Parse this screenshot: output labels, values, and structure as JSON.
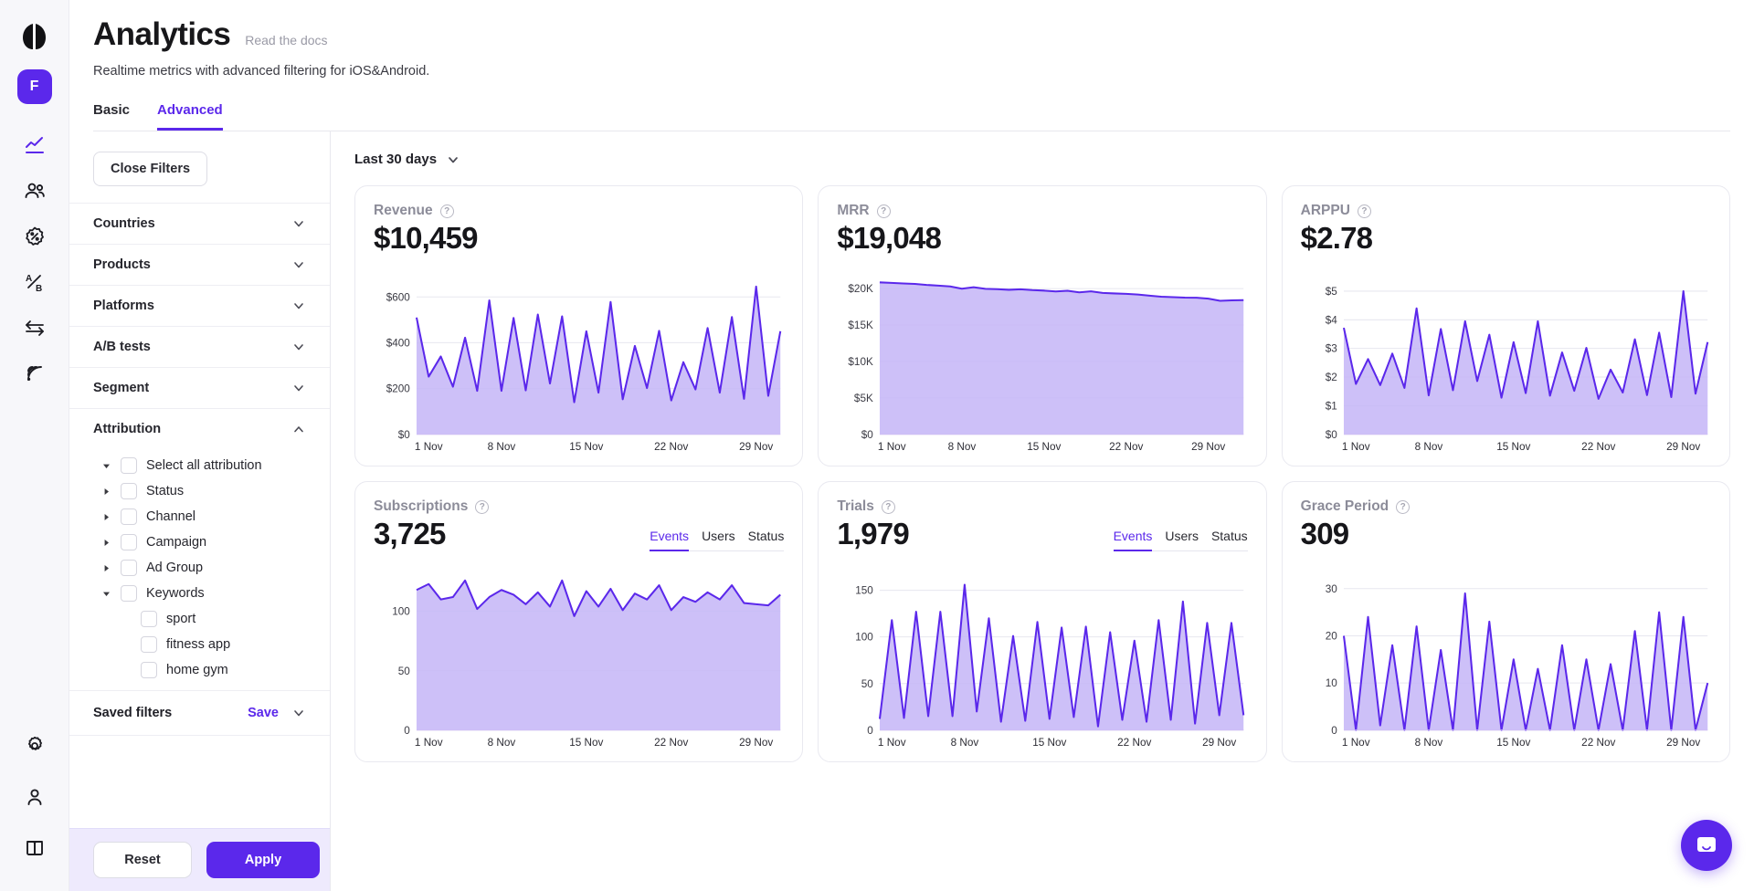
{
  "brand": {
    "accent": "#5b28eb",
    "area_fill": "#c4b5f7",
    "workspace_initial": "F"
  },
  "rail": {
    "items": [
      {
        "name": "analytics-icon",
        "label": "Analytics",
        "active": true
      },
      {
        "name": "users-icon",
        "label": "Users",
        "active": false
      },
      {
        "name": "promo-icon",
        "label": "Promo",
        "active": false
      },
      {
        "name": "ab-test-icon",
        "label": "A/B Tests",
        "active": false
      },
      {
        "name": "integrations-icon",
        "label": "Integrations",
        "active": false
      },
      {
        "name": "broadcast-icon",
        "label": "Broadcast",
        "active": false
      }
    ],
    "bottom": [
      {
        "name": "gear-icon",
        "label": "Settings"
      },
      {
        "name": "user-icon",
        "label": "Account"
      },
      {
        "name": "docs-icon",
        "label": "Docs"
      }
    ]
  },
  "header": {
    "title": "Analytics",
    "docs_link": "Read the docs",
    "subtitle": "Realtime metrics with advanced filtering for iOS&Android.",
    "tabs": [
      {
        "label": "Basic",
        "active": false
      },
      {
        "label": "Advanced",
        "active": true
      }
    ]
  },
  "filters": {
    "close_button": "Close Filters",
    "facets": [
      {
        "label": "Countries",
        "expanded": false
      },
      {
        "label": "Products",
        "expanded": false
      },
      {
        "label": "Platforms",
        "expanded": false
      },
      {
        "label": "A/B tests",
        "expanded": false
      },
      {
        "label": "Segment",
        "expanded": false
      },
      {
        "label": "Attribution",
        "expanded": true
      }
    ],
    "attribution_tree": [
      {
        "label": "Select all attribution",
        "caret": "down",
        "indent": 0,
        "checked": false
      },
      {
        "label": "Status",
        "caret": "right",
        "indent": 0,
        "checked": false
      },
      {
        "label": "Channel",
        "caret": "right",
        "indent": 0,
        "checked": false
      },
      {
        "label": "Campaign",
        "caret": "right",
        "indent": 0,
        "checked": false
      },
      {
        "label": "Ad Group",
        "caret": "right",
        "indent": 0,
        "checked": false
      },
      {
        "label": "Keywords",
        "caret": "down",
        "indent": 0,
        "checked": false
      },
      {
        "label": "sport",
        "caret": "none",
        "indent": 1,
        "checked": false
      },
      {
        "label": "fitness app",
        "caret": "none",
        "indent": 1,
        "checked": false
      },
      {
        "label": "home gym",
        "caret": "none",
        "indent": 1,
        "checked": false
      }
    ],
    "saved_filters_label": "Saved filters",
    "save_link": "Save",
    "reset_button": "Reset",
    "apply_button": "Apply"
  },
  "toolbar": {
    "date_range": "Last 30 days"
  },
  "chart_data": [
    {
      "type": "area",
      "title": "Revenue",
      "metric": "$10,459",
      "xlabel": "",
      "ylabel": "",
      "ylim": [
        0,
        700
      ],
      "yticks": [
        0,
        200,
        400,
        600
      ],
      "ytick_labels": [
        "$0",
        "$200",
        "$400",
        "$600"
      ],
      "xtick_labels": [
        "1 Nov",
        "8 Nov",
        "15 Nov",
        "22 Nov",
        "29 Nov"
      ],
      "xtick_indices": [
        0,
        7,
        14,
        21,
        28
      ],
      "x": [
        "1 Nov",
        "2 Nov",
        "3 Nov",
        "4 Nov",
        "5 Nov",
        "6 Nov",
        "7 Nov",
        "8 Nov",
        "9 Nov",
        "10 Nov",
        "11 Nov",
        "12 Nov",
        "13 Nov",
        "14 Nov",
        "15 Nov",
        "16 Nov",
        "17 Nov",
        "18 Nov",
        "19 Nov",
        "20 Nov",
        "21 Nov",
        "22 Nov",
        "23 Nov",
        "24 Nov",
        "25 Nov",
        "26 Nov",
        "27 Nov",
        "28 Nov",
        "29 Nov",
        "30 Nov"
      ],
      "values": [
        510,
        252,
        340,
        208,
        422,
        190,
        585,
        190,
        508,
        192,
        523,
        222,
        515,
        140,
        450,
        182,
        578,
        153,
        386,
        202,
        452,
        148,
        315,
        196,
        464,
        182,
        512,
        155,
        645,
        168,
        450
      ],
      "grid": true,
      "legend": null
    },
    {
      "type": "area",
      "title": "MRR",
      "metric": "$19,048",
      "xlabel": "",
      "ylabel": "",
      "ylim": [
        0,
        22000
      ],
      "yticks": [
        0,
        5000,
        10000,
        15000,
        20000
      ],
      "ytick_labels": [
        "$0",
        "$5K",
        "$10K",
        "$15K",
        "$20K"
      ],
      "xtick_labels": [
        "1 Nov",
        "8 Nov",
        "15 Nov",
        "22 Nov",
        "29 Nov"
      ],
      "xtick_indices": [
        0,
        7,
        14,
        21,
        28
      ],
      "x": [
        "1 Nov",
        "2 Nov",
        "3 Nov",
        "4 Nov",
        "5 Nov",
        "6 Nov",
        "7 Nov",
        "8 Nov",
        "9 Nov",
        "10 Nov",
        "11 Nov",
        "12 Nov",
        "13 Nov",
        "14 Nov",
        "15 Nov",
        "16 Nov",
        "17 Nov",
        "18 Nov",
        "19 Nov",
        "20 Nov",
        "21 Nov",
        "22 Nov",
        "23 Nov",
        "24 Nov",
        "25 Nov",
        "26 Nov",
        "27 Nov",
        "28 Nov",
        "29 Nov",
        "30 Nov"
      ],
      "values": [
        20850,
        20780,
        20700,
        20640,
        20500,
        20400,
        20290,
        19980,
        20180,
        19970,
        19920,
        19830,
        19900,
        19790,
        19720,
        19600,
        19700,
        19480,
        19620,
        19400,
        19330,
        19280,
        19180,
        19020,
        18880,
        18820,
        18760,
        18740,
        18620,
        18320,
        18380,
        18420
      ],
      "grid": true,
      "legend": null
    },
    {
      "type": "area",
      "title": "ARPPU",
      "metric": "$2.78",
      "xlabel": "",
      "ylabel": "",
      "ylim": [
        0,
        5.6
      ],
      "yticks": [
        0,
        1,
        2,
        3,
        4,
        5
      ],
      "ytick_labels": [
        "$0",
        "$1",
        "$2",
        "$3",
        "$4",
        "$5"
      ],
      "xtick_labels": [
        "1 Nov",
        "8 Nov",
        "15 Nov",
        "22 Nov",
        "29 Nov"
      ],
      "xtick_indices": [
        0,
        7,
        14,
        21,
        28
      ],
      "x": [
        "1 Nov",
        "2 Nov",
        "3 Nov",
        "4 Nov",
        "5 Nov",
        "6 Nov",
        "7 Nov",
        "8 Nov",
        "9 Nov",
        "10 Nov",
        "11 Nov",
        "12 Nov",
        "13 Nov",
        "14 Nov",
        "15 Nov",
        "16 Nov",
        "17 Nov",
        "18 Nov",
        "19 Nov",
        "20 Nov",
        "21 Nov",
        "22 Nov",
        "23 Nov",
        "24 Nov",
        "25 Nov",
        "26 Nov",
        "27 Nov",
        "28 Nov",
        "29 Nov",
        "30 Nov"
      ],
      "values": [
        3.72,
        1.76,
        2.63,
        1.72,
        2.82,
        1.62,
        4.4,
        1.36,
        3.68,
        1.54,
        3.95,
        1.86,
        3.48,
        1.28,
        3.22,
        1.44,
        3.95,
        1.35,
        2.86,
        1.52,
        3.02,
        1.24,
        2.26,
        1.46,
        3.32,
        1.37,
        3.55,
        1.3,
        5.0,
        1.42,
        3.22
      ],
      "grid": true,
      "legend": null
    },
    {
      "type": "area",
      "title": "Subscriptions",
      "metric": "3,725",
      "xlabel": "",
      "ylabel": "",
      "ylim": [
        0,
        135
      ],
      "yticks": [
        0,
        50,
        100
      ],
      "ytick_labels": [
        "0",
        "50",
        "100"
      ],
      "xtick_labels": [
        "1 Nov",
        "8 Nov",
        "15 Nov",
        "22 Nov",
        "29 Nov"
      ],
      "xtick_indices": [
        0,
        7,
        14,
        21,
        28
      ],
      "x": [
        "1 Nov",
        "2 Nov",
        "3 Nov",
        "4 Nov",
        "5 Nov",
        "6 Nov",
        "7 Nov",
        "8 Nov",
        "9 Nov",
        "10 Nov",
        "11 Nov",
        "12 Nov",
        "13 Nov",
        "14 Nov",
        "15 Nov",
        "16 Nov",
        "17 Nov",
        "18 Nov",
        "19 Nov",
        "20 Nov",
        "21 Nov",
        "22 Nov",
        "23 Nov",
        "24 Nov",
        "25 Nov",
        "26 Nov",
        "27 Nov",
        "28 Nov",
        "29 Nov",
        "30 Nov"
      ],
      "values": [
        118,
        123,
        110,
        112,
        126,
        102,
        112,
        118,
        114,
        106,
        116,
        104,
        126,
        96,
        117,
        104,
        119,
        101,
        115,
        110,
        122,
        101,
        112,
        108,
        116,
        110,
        122,
        107,
        106,
        105,
        114
      ],
      "tabs": [
        {
          "label": "Events",
          "active": true
        },
        {
          "label": "Users",
          "active": false
        },
        {
          "label": "Status",
          "active": false
        }
      ],
      "grid": true,
      "legend": null
    },
    {
      "type": "area",
      "title": "Trials",
      "metric": "1,979",
      "xlabel": "",
      "ylabel": "",
      "ylim": [
        0,
        172
      ],
      "yticks": [
        0,
        50,
        100,
        150
      ],
      "ytick_labels": [
        "0",
        "50",
        "100",
        "150"
      ],
      "xtick_labels": [
        "1 Nov",
        "8 Nov",
        "15 Nov",
        "22 Nov",
        "29 Nov"
      ],
      "xtick_indices": [
        0,
        7,
        14,
        21,
        28
      ],
      "x": [
        "1 Nov",
        "2 Nov",
        "3 Nov",
        "4 Nov",
        "5 Nov",
        "6 Nov",
        "7 Nov",
        "8 Nov",
        "9 Nov",
        "10 Nov",
        "11 Nov",
        "12 Nov",
        "13 Nov",
        "14 Nov",
        "15 Nov",
        "16 Nov",
        "17 Nov",
        "18 Nov",
        "19 Nov",
        "20 Nov",
        "21 Nov",
        "22 Nov",
        "23 Nov",
        "24 Nov",
        "25 Nov",
        "26 Nov",
        "27 Nov",
        "28 Nov",
        "29 Nov",
        "30 Nov"
      ],
      "values": [
        12,
        118,
        13,
        127,
        15,
        127,
        15,
        156,
        20,
        120,
        9,
        101,
        10,
        116,
        12,
        110,
        14,
        111,
        4,
        105,
        11,
        96,
        9,
        118,
        11,
        138,
        7,
        115,
        16,
        115,
        16
      ],
      "tabs": [
        {
          "label": "Events",
          "active": true
        },
        {
          "label": "Users",
          "active": false
        },
        {
          "label": "Status",
          "active": false
        }
      ],
      "grid": true,
      "legend": null
    },
    {
      "type": "area",
      "title": "Grace Period",
      "metric": "309",
      "xlabel": "",
      "ylabel": "",
      "ylim": [
        0,
        34
      ],
      "yticks": [
        0,
        10,
        20,
        30
      ],
      "ytick_labels": [
        "0",
        "10",
        "20",
        "30"
      ],
      "xtick_labels": [
        "1 Nov",
        "8 Nov",
        "15 Nov",
        "22 Nov",
        "29 Nov"
      ],
      "xtick_indices": [
        0,
        7,
        14,
        21,
        28
      ],
      "x": [
        "1 Nov",
        "2 Nov",
        "3 Nov",
        "4 Nov",
        "5 Nov",
        "6 Nov",
        "7 Nov",
        "8 Nov",
        "9 Nov",
        "10 Nov",
        "11 Nov",
        "12 Nov",
        "13 Nov",
        "14 Nov",
        "15 Nov",
        "16 Nov",
        "17 Nov",
        "18 Nov",
        "19 Nov",
        "20 Nov",
        "21 Nov",
        "22 Nov",
        "23 Nov",
        "24 Nov",
        "25 Nov",
        "26 Nov",
        "27 Nov",
        "28 Nov",
        "29 Nov",
        "30 Nov"
      ],
      "values": [
        20,
        0,
        24,
        1,
        18,
        0,
        22,
        0,
        17,
        0,
        29,
        0,
        23,
        0,
        15,
        0,
        13,
        0,
        18,
        0,
        15,
        0,
        14,
        0,
        21,
        0,
        25,
        0,
        24,
        0,
        10
      ],
      "grid": true,
      "legend": null
    }
  ]
}
